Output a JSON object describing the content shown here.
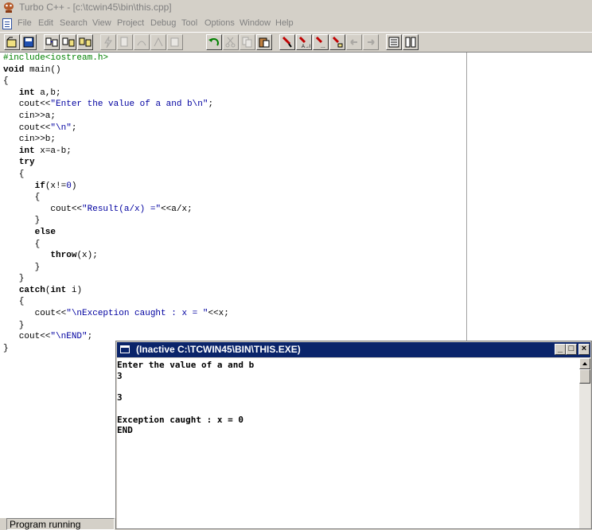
{
  "window": {
    "title": "Turbo C++ - [c:\\tcwin45\\bin\\this.cpp]"
  },
  "menu": [
    {
      "label": "File",
      "name": "menu-file"
    },
    {
      "label": "Edit",
      "name": "menu-edit"
    },
    {
      "label": "Search",
      "name": "menu-search"
    },
    {
      "label": "View",
      "name": "menu-view"
    },
    {
      "label": "Project",
      "name": "menu-project"
    },
    {
      "label": "Debug",
      "name": "menu-debug"
    },
    {
      "label": "Tool",
      "name": "menu-tool"
    },
    {
      "label": "Options",
      "name": "menu-options"
    },
    {
      "label": "Window",
      "name": "menu-window"
    },
    {
      "label": "Help",
      "name": "menu-help"
    }
  ],
  "toolbar": {
    "icons": [
      "open-file-icon",
      "save-file-icon",
      "compile-icon",
      "make-icon",
      "build-icon",
      "lightning-run-icon",
      "step-into-icon",
      "step-over-icon",
      "trace-icon",
      "run-to-cursor-icon",
      "undo-icon",
      "cut-icon",
      "copy-icon",
      "paste-icon",
      "search-icon",
      "replace-icon",
      "search-again-icon",
      "find-next-icon",
      "previous-icon",
      "next-icon",
      "window-list-icon",
      "tile-icon"
    ]
  },
  "editor": {
    "lines": [
      [
        {
          "t": "#include<iostream.h>",
          "c": "pp"
        }
      ],
      [
        {
          "t": "void",
          "c": "kw"
        },
        {
          "t": " main()",
          "c": ""
        }
      ],
      [
        {
          "t": "{",
          "c": ""
        }
      ],
      [
        {
          "t": "   ",
          "c": ""
        },
        {
          "t": "int",
          "c": "kw"
        },
        {
          "t": " a,b;",
          "c": ""
        }
      ],
      [
        {
          "t": "   cout<<",
          "c": ""
        },
        {
          "t": "\"Enter the value of a and b\\n\"",
          "c": "str"
        },
        {
          "t": ";",
          "c": ""
        }
      ],
      [
        {
          "t": "   cin>>a;",
          "c": ""
        }
      ],
      [
        {
          "t": "   cout<<",
          "c": ""
        },
        {
          "t": "\"\\n\"",
          "c": "str"
        },
        {
          "t": ";",
          "c": ""
        }
      ],
      [
        {
          "t": "   cin>>b;",
          "c": ""
        }
      ],
      [
        {
          "t": "   ",
          "c": ""
        },
        {
          "t": "int",
          "c": "kw"
        },
        {
          "t": " x=a-b;",
          "c": ""
        }
      ],
      [
        {
          "t": "   ",
          "c": ""
        },
        {
          "t": "try",
          "c": "kw"
        }
      ],
      [
        {
          "t": "   {",
          "c": ""
        }
      ],
      [
        {
          "t": "      ",
          "c": ""
        },
        {
          "t": "if",
          "c": "kw"
        },
        {
          "t": "(x!=",
          "c": ""
        },
        {
          "t": "0",
          "c": "str"
        },
        {
          "t": ")",
          "c": ""
        }
      ],
      [
        {
          "t": "      {",
          "c": ""
        }
      ],
      [
        {
          "t": "         cout<<",
          "c": ""
        },
        {
          "t": "\"Result(a/x) =\"",
          "c": "str"
        },
        {
          "t": "<<a/x;",
          "c": ""
        }
      ],
      [
        {
          "t": "      }",
          "c": ""
        }
      ],
      [
        {
          "t": "      ",
          "c": ""
        },
        {
          "t": "else",
          "c": "kw"
        }
      ],
      [
        {
          "t": "      {",
          "c": ""
        }
      ],
      [
        {
          "t": "         ",
          "c": ""
        },
        {
          "t": "throw",
          "c": "kw"
        },
        {
          "t": "(x);",
          "c": ""
        }
      ],
      [
        {
          "t": "      }",
          "c": ""
        }
      ],
      [
        {
          "t": "   }",
          "c": ""
        }
      ],
      [
        {
          "t": "   ",
          "c": ""
        },
        {
          "t": "catch",
          "c": "kw"
        },
        {
          "t": "(",
          "c": ""
        },
        {
          "t": "int",
          "c": "kw"
        },
        {
          "t": " i)",
          "c": ""
        }
      ],
      [
        {
          "t": "   {",
          "c": ""
        }
      ],
      [
        {
          "t": "      cout<<",
          "c": ""
        },
        {
          "t": "\"\\nException caught : x = \"",
          "c": "str"
        },
        {
          "t": "<<x;",
          "c": ""
        }
      ],
      [
        {
          "t": "   }",
          "c": ""
        }
      ],
      [
        {
          "t": "   cout<<",
          "c": ""
        },
        {
          "t": "\"\\nEND\"",
          "c": "str"
        },
        {
          "t": ";",
          "c": ""
        }
      ],
      [
        {
          "t": "}",
          "c": ""
        }
      ]
    ]
  },
  "output_window": {
    "title": "(Inactive C:\\TCWIN45\\BIN\\THIS.EXE)",
    "text": "Enter the value of a and b\n3\n\n3\n\nException caught : x = 0\nEND",
    "buttons": {
      "minimize": "_",
      "maximize": "□",
      "close": "×"
    }
  },
  "status": {
    "text": "Program running"
  }
}
